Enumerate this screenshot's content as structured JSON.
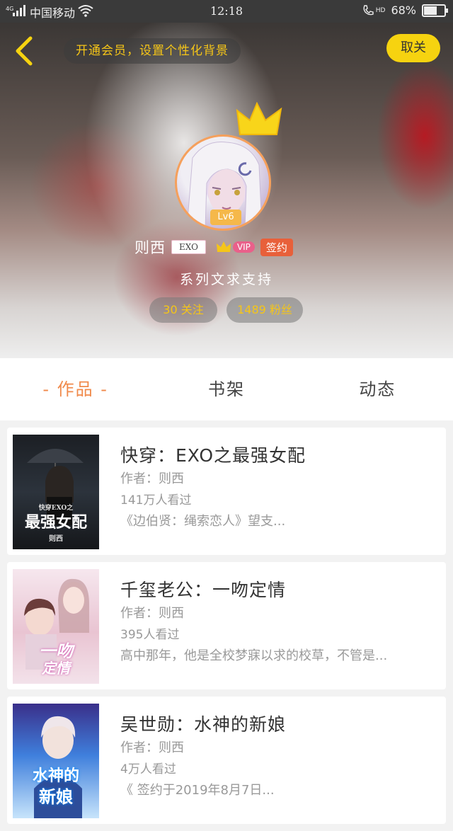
{
  "status_bar": {
    "carrier": "中国移动",
    "network": "4G",
    "time": "12:18",
    "hd": "HD",
    "battery_percent": "68%",
    "battery_level": 0.68
  },
  "header": {
    "vip_banner": "开通会员，设置个性化背景",
    "cancel_label": "取关",
    "level": "Lv6",
    "user_name": "则西",
    "user_tag": "EXO",
    "vip_label": "VIP",
    "sign_label": "签约",
    "signature": "系列文求支持",
    "following": "30 关注",
    "fans": "1489 粉丝"
  },
  "tabs": [
    {
      "label": "- 作品 -",
      "active": true
    },
    {
      "label": "书架",
      "active": false
    },
    {
      "label": "动态",
      "active": false
    }
  ],
  "books": [
    {
      "title": "快穿：EXO之最强女配",
      "author": "作者：则西",
      "views": "141万人看过",
      "desc": "《边伯贤：绳索恋人》望支...",
      "cover_lines": [
        "快穿EXO之",
        "最强女配",
        "则西"
      ]
    },
    {
      "title": "千玺老公：一吻定情",
      "author": "作者：则西",
      "views": "395人看过",
      "desc": "高中那年，他是全校梦寐以求的校草，不管是...",
      "cover_lines": [
        "一吻",
        "定情"
      ]
    },
    {
      "title": "吴世勋：水神的新娘",
      "author": "作者：则西",
      "views": "4万人看过",
      "desc": "《 签约于2019年8月7日...",
      "cover_lines": [
        "水神的",
        "新娘"
      ]
    }
  ],
  "colors": {
    "accent_orange": "#f08a4b",
    "gold": "#f5c518",
    "cancel_yellow": "#f6d310",
    "sign_red": "#e8603a"
  }
}
